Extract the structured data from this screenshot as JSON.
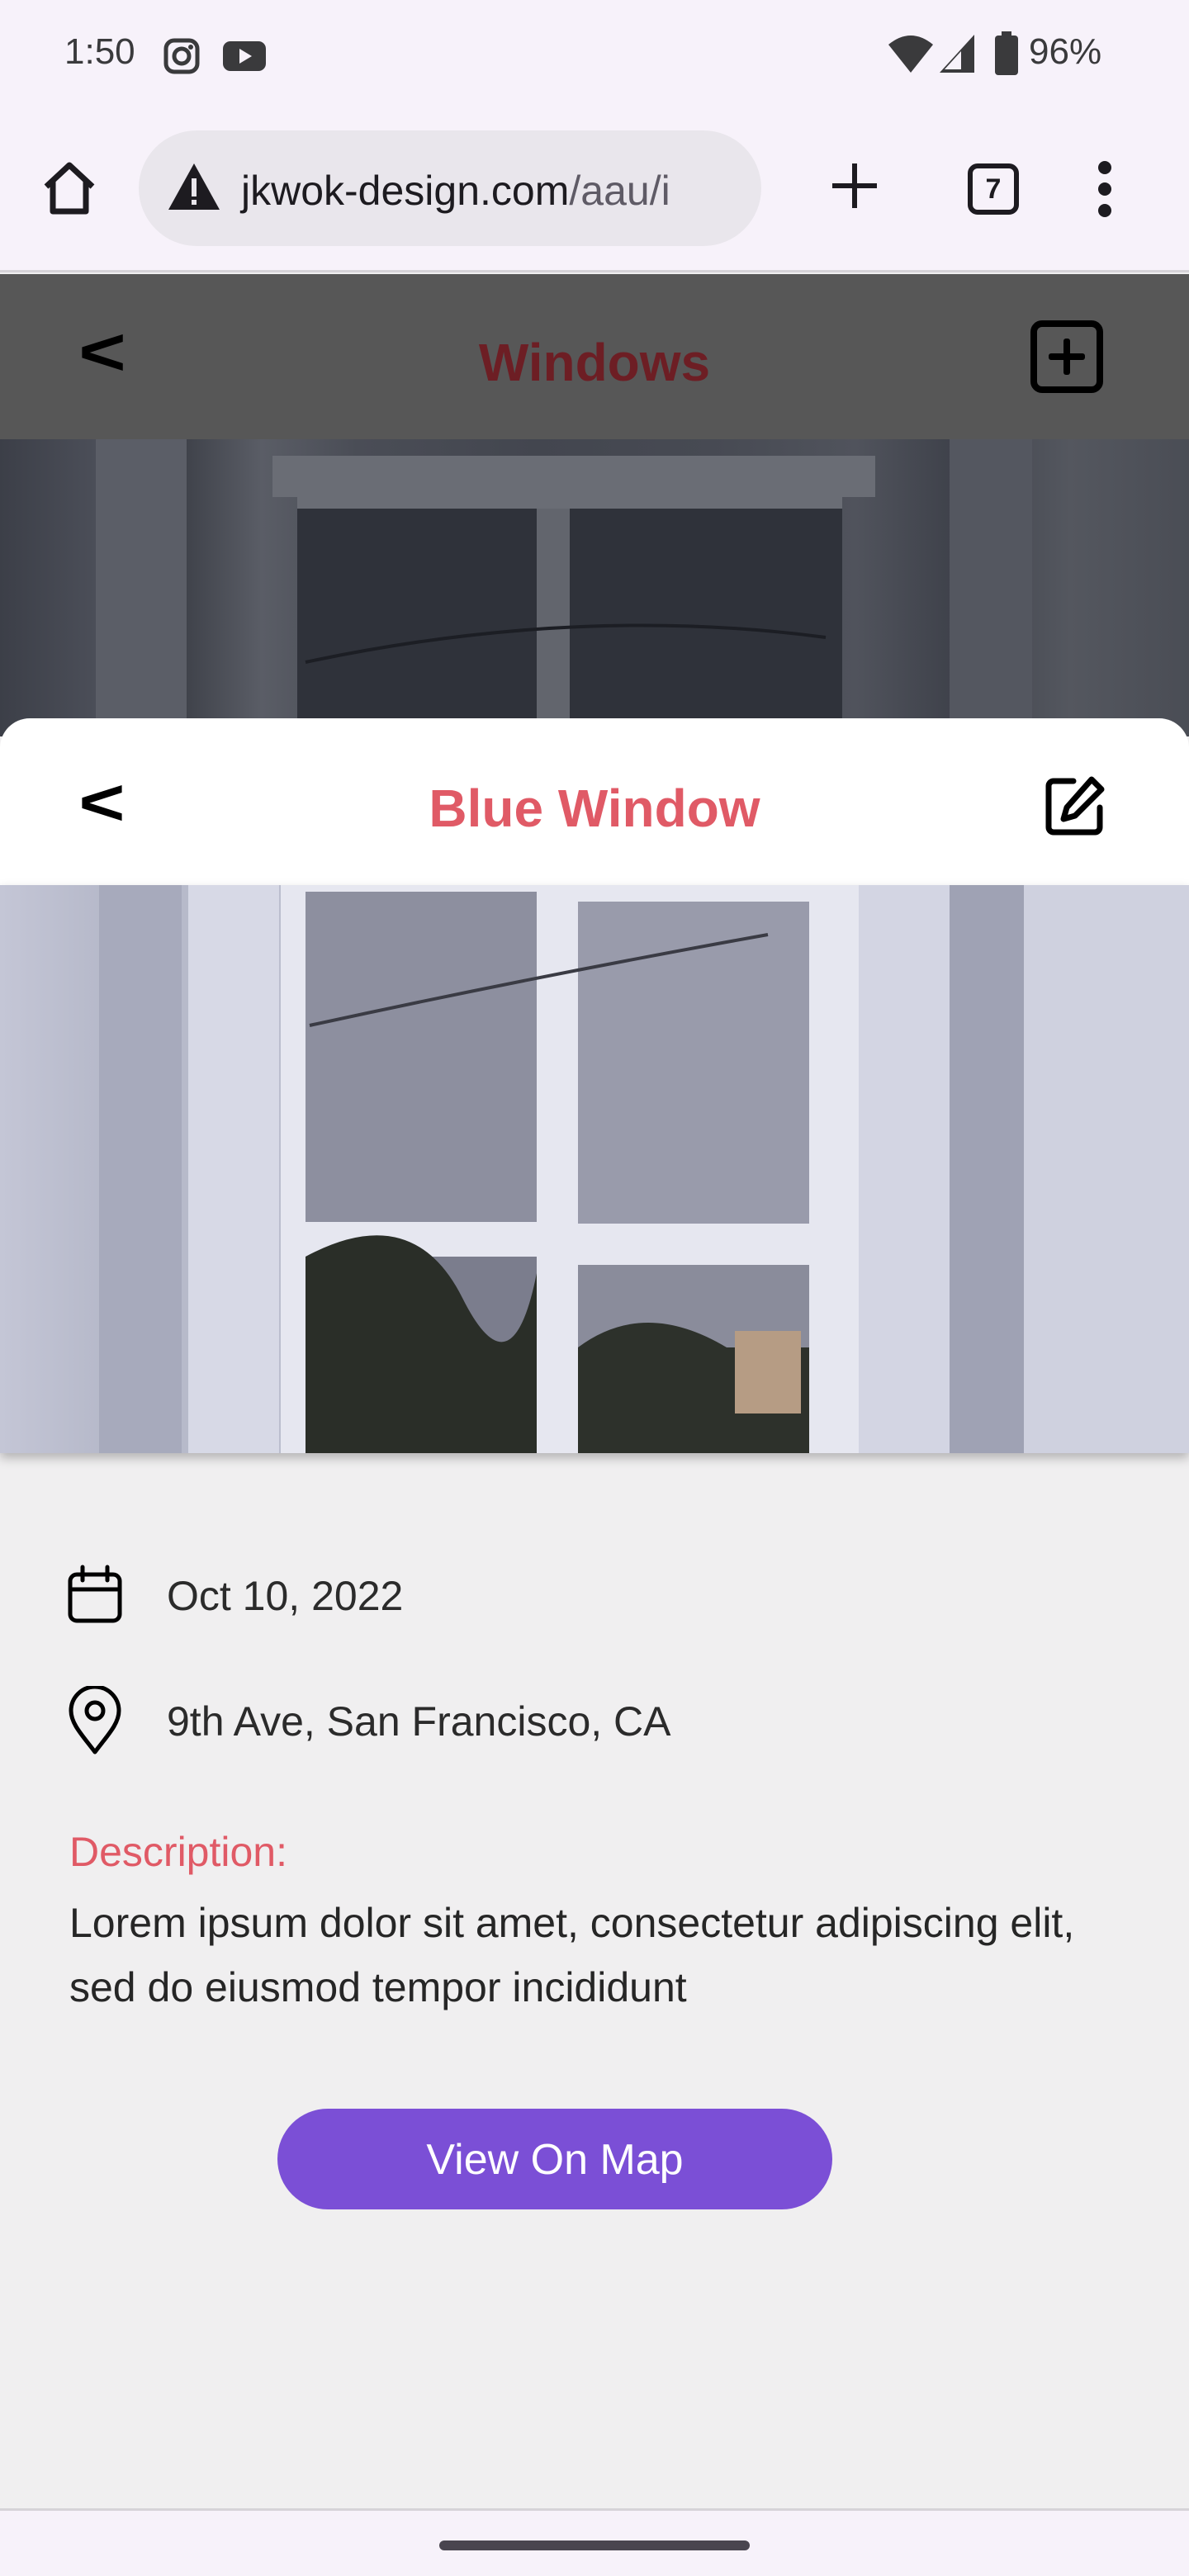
{
  "status_bar": {
    "time": "1:50",
    "battery": "96%",
    "icons": [
      "instagram-icon",
      "youtube-icon",
      "wifi-icon",
      "signal-icon",
      "battery-icon"
    ]
  },
  "browser": {
    "url_host": "jkwok-design.com",
    "url_path": "/aau/i",
    "tab_count": "7",
    "icons": [
      "home-icon",
      "warning-icon",
      "new-tab-icon",
      "tabs-icon",
      "more-vert-icon"
    ]
  },
  "background_screen": {
    "back_label": "<",
    "title": "Windows"
  },
  "detail_sheet": {
    "back_label": "<",
    "title": "Blue Window",
    "date": "Oct 10, 2022",
    "location": "9th Ave, San Francisco, CA",
    "description_label": "Description:",
    "description_text": "Lorem ipsum dolor sit amet, consectetur adipiscing elit, sed do eiusmod tempor incididunt",
    "map_button": "View On Map"
  },
  "colors": {
    "accent_red": "#e05a66",
    "button_purple": "#7b4fd6",
    "dim_title": "#6d1e24"
  }
}
